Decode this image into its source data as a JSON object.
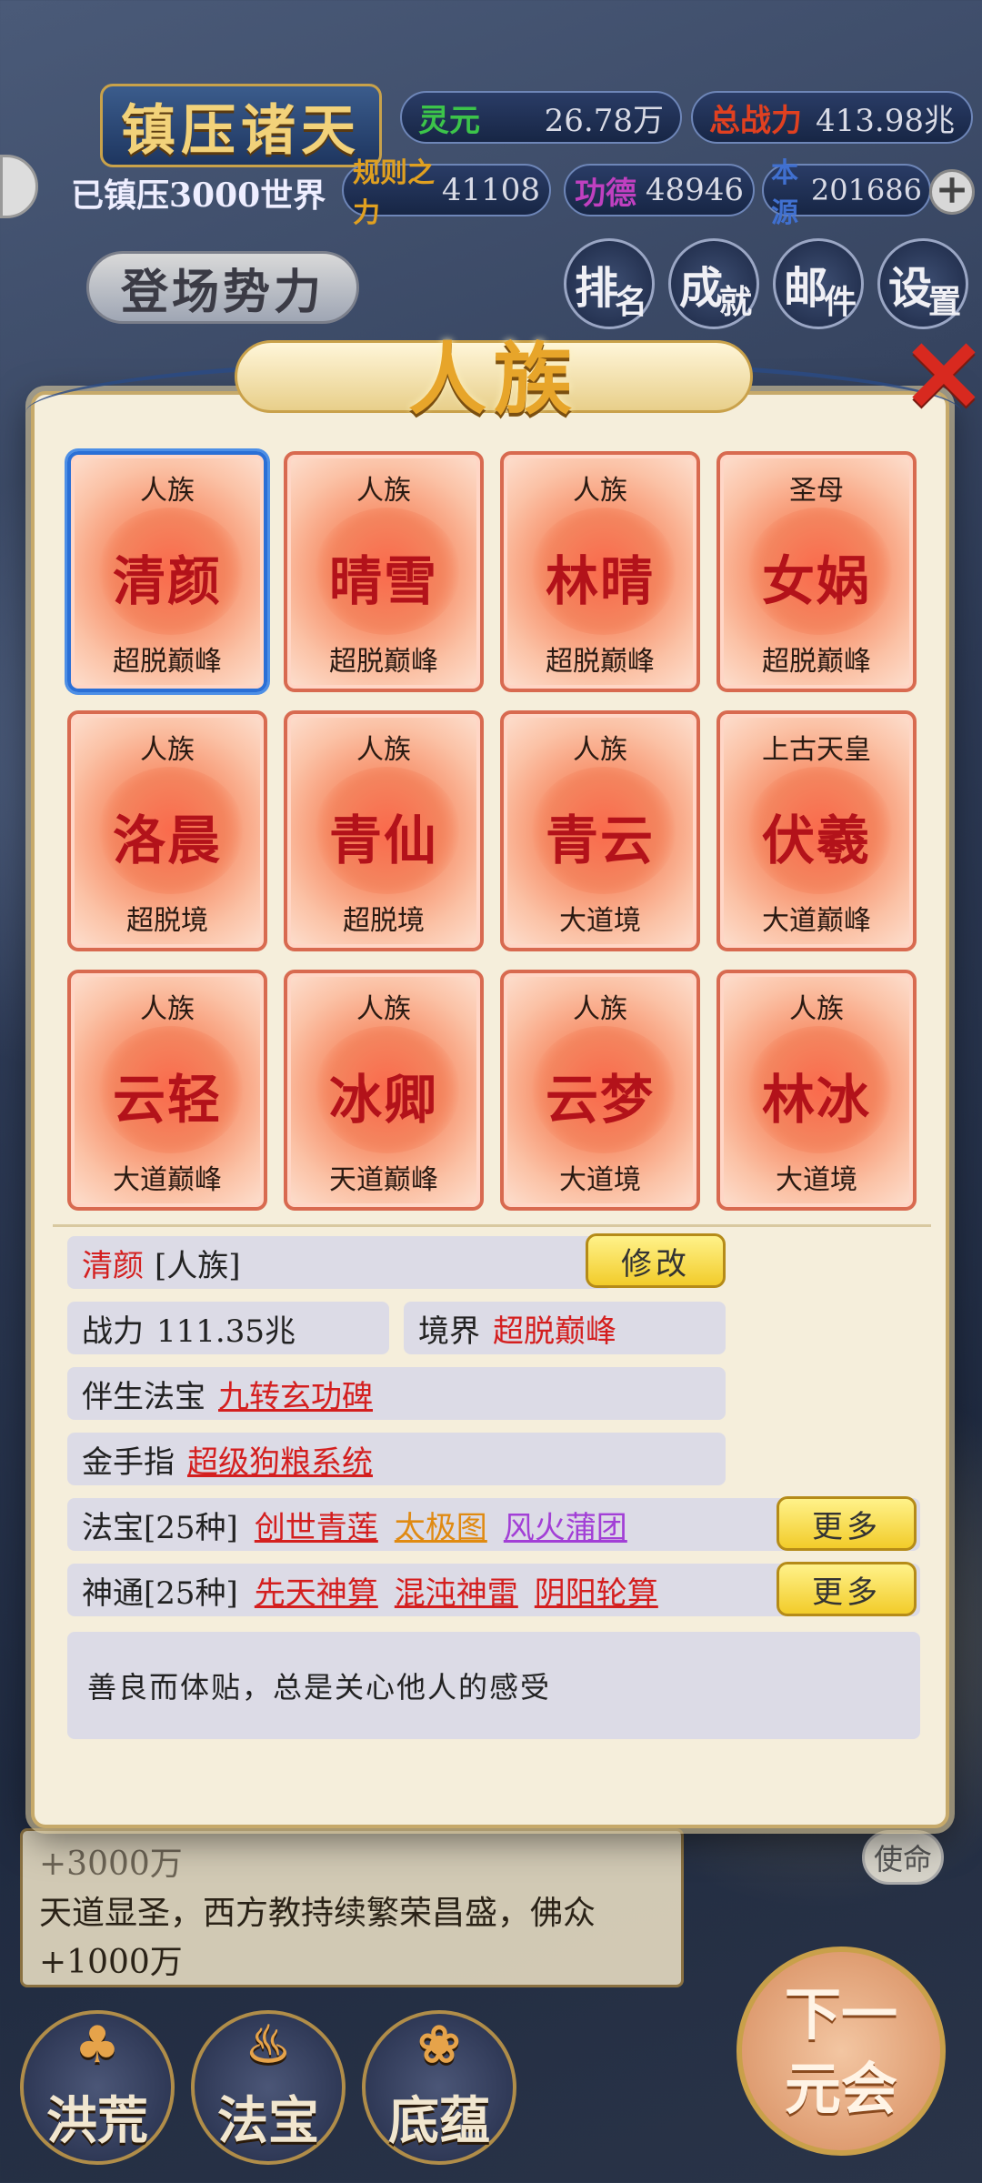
{
  "header": {
    "title": "镇压诸天",
    "subtitle": "已镇压3000世界",
    "enter_label": "登场势力",
    "stats": [
      {
        "key": "灵元",
        "value": "26.78万",
        "color": "#3cc44a"
      },
      {
        "key": "总战力",
        "value": "413.98兆",
        "color": "#e04020"
      },
      {
        "key": "规则之力",
        "value": "41108",
        "color": "#e0a020"
      },
      {
        "key": "功德",
        "value": "48946",
        "color": "#c040c0"
      },
      {
        "key": "本源",
        "value": "201686",
        "color": "#4070d0"
      }
    ],
    "nav": [
      {
        "big": "排",
        "small": "名"
      },
      {
        "big": "成",
        "small": "就"
      },
      {
        "big": "邮",
        "small": "件"
      },
      {
        "big": "设",
        "small": "置"
      }
    ]
  },
  "dialog": {
    "title": "人族",
    "close_icon": "close-x-icon",
    "characters": [
      {
        "race": "人族",
        "name": "清颜",
        "realm": "超脱巅峰",
        "selected": true
      },
      {
        "race": "人族",
        "name": "晴雪",
        "realm": "超脱巅峰"
      },
      {
        "race": "人族",
        "name": "林晴",
        "realm": "超脱巅峰"
      },
      {
        "race": "圣母",
        "name": "女娲",
        "realm": "超脱巅峰"
      },
      {
        "race": "人族",
        "name": "洛晨",
        "realm": "超脱境"
      },
      {
        "race": "人族",
        "name": "青仙",
        "realm": "超脱境"
      },
      {
        "race": "人族",
        "name": "青云",
        "realm": "大道境"
      },
      {
        "race": "上古天皇",
        "name": "伏羲",
        "realm": "大道巅峰"
      },
      {
        "race": "人族",
        "name": "云轻",
        "realm": "大道巅峰"
      },
      {
        "race": "人族",
        "name": "冰卿",
        "realm": "天道巅峰"
      },
      {
        "race": "人族",
        "name": "云梦",
        "realm": "大道境"
      },
      {
        "race": "人族",
        "name": "林冰",
        "realm": "大道境"
      }
    ],
    "detail": {
      "name": "清颜",
      "race_tag": "[人族]",
      "edit_label": "修改",
      "power_label": "战力",
      "power_value": "111.35兆",
      "realm_label": "境界",
      "realm_value": "超脱巅峰",
      "companion_label": "伴生法宝",
      "companion_value": "九转玄功碑",
      "cheat_label": "金手指",
      "cheat_value": "超级狗粮系统",
      "treasure_label": "法宝[25种]",
      "treasures": [
        "创世青莲",
        "太极图",
        "风火蒲团"
      ],
      "skill_label": "神通[25种]",
      "skills": [
        "先天神算",
        "混沌神雷",
        "阴阳轮算"
      ],
      "more_label": "更多",
      "description": "善良而体贴，总是关心他人的感受"
    }
  },
  "log": {
    "line0": "+3000万",
    "line1": "天道显圣，西方教持续繁荣昌盛，佛众",
    "line2": "+1000万"
  },
  "side_button": "使命",
  "next_era": {
    "line1": "下一",
    "line2": "元会"
  },
  "bottom_tabs": [
    {
      "label": "洪荒",
      "icon": "tree-icon"
    },
    {
      "label": "法宝",
      "icon": "cauldron-icon"
    },
    {
      "label": "底蕴",
      "icon": "lotus-icon"
    }
  ]
}
